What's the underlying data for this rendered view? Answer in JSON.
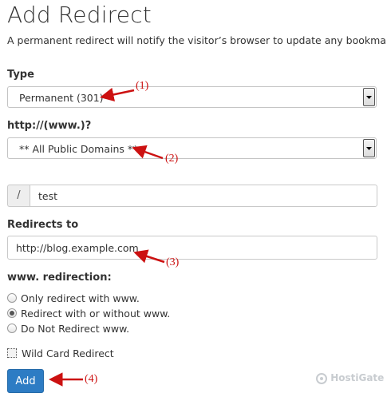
{
  "header": {
    "title": "Add Redirect",
    "description": "A permanent redirect will notify the visitor’s browser to update any bookmarks tha"
  },
  "type_field": {
    "label": "Type",
    "selected": "Permanent (301)"
  },
  "domain_field": {
    "label": "http://(www.)?",
    "selected": "** All Public Domains **"
  },
  "path_field": {
    "prefix": "/",
    "value": "test"
  },
  "redirect_field": {
    "label": "Redirects to",
    "value": "http://blog.example.com"
  },
  "www_redirection": {
    "label": "www. redirection:",
    "options": [
      {
        "label": "Only redirect with www.",
        "checked": false
      },
      {
        "label": "Redirect with or without www.",
        "checked": true
      },
      {
        "label": "Do Not Redirect www.",
        "checked": false
      }
    ]
  },
  "wildcard": {
    "label": "Wild Card Redirect",
    "checked": false
  },
  "actions": {
    "add_label": "Add"
  },
  "annotations": [
    "(1)",
    "(2)",
    "(3)",
    "(4)"
  ],
  "watermark": {
    "text": "HostiGate"
  },
  "colors": {
    "primary_button": "#2d7cc4",
    "annotation": "#cc1111"
  }
}
